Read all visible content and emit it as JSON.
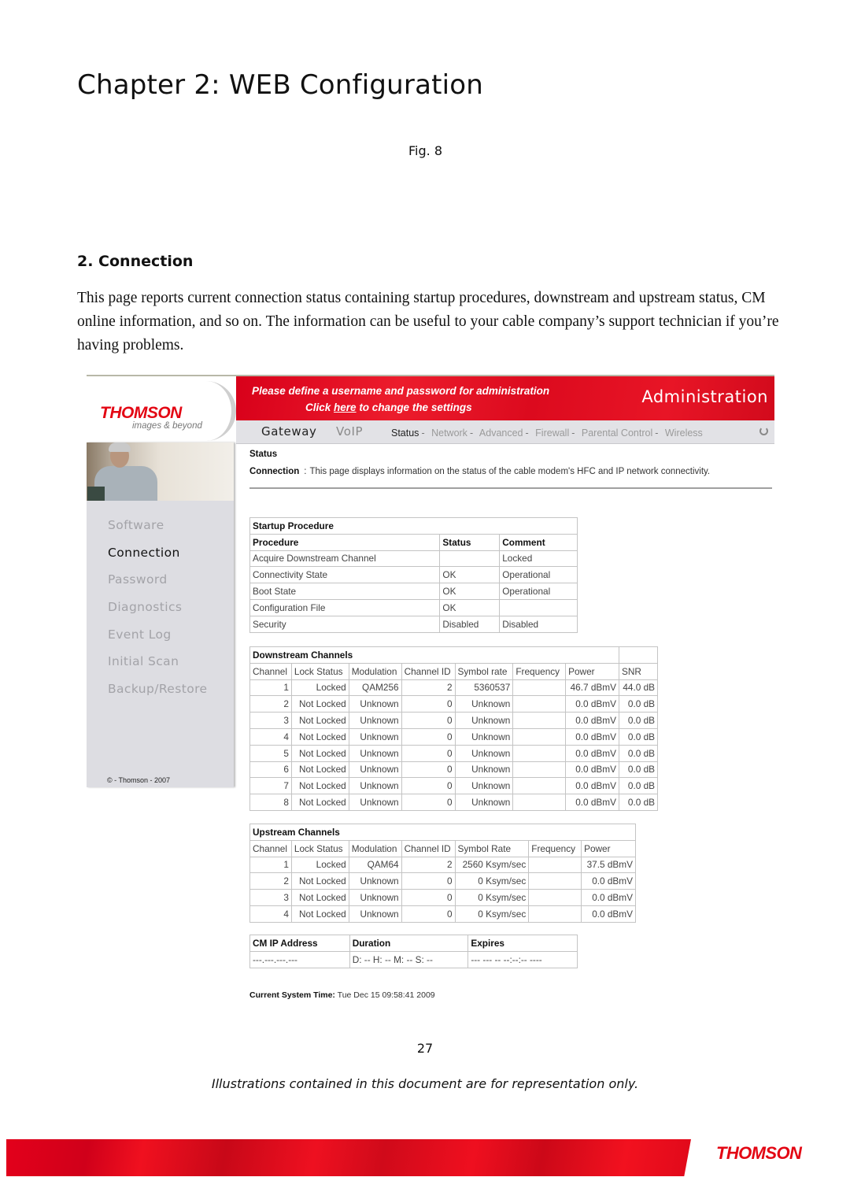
{
  "document": {
    "chapter_title": "Chapter 2: WEB Configuration",
    "fig_label": "Fig. 8",
    "section_heading": "2. Connection",
    "intro_paragraph": "This page reports current connection status containing startup procedures, downstream and upstream status, CM online information, and so on. The information can be useful to your cable company’s support technician if you’re having problems.",
    "page_number": "27",
    "disclaimer": "Illustrations contained in this document are for representation only.",
    "footer_logo": "THOMSON"
  },
  "screenshot": {
    "logo": {
      "brand": "THOMSON",
      "tagline": "images & beyond"
    },
    "banner": {
      "line1": "Please define a username and password for administration",
      "line2_prefix": "Click ",
      "line2_link": "here",
      "line2_suffix": " to change the settings",
      "title": "Administration"
    },
    "nav": {
      "main": [
        "Gateway",
        "VoIP"
      ],
      "sub": [
        {
          "label": "Status",
          "active": true
        },
        {
          "label": "Network",
          "active": false
        },
        {
          "label": "Advanced",
          "active": false
        },
        {
          "label": "Firewall",
          "active": false
        },
        {
          "label": "Parental Control",
          "active": false
        },
        {
          "label": "Wireless",
          "active": false
        }
      ],
      "separator": "-",
      "refresh_icon": "refresh-icon"
    },
    "sidebar": {
      "items": [
        "Software",
        "Connection",
        "Password",
        "Diagnostics",
        "Event Log",
        "Initial Scan",
        "Backup/Restore"
      ],
      "active_index": 1,
      "copyright": "© - Thomson - 2007"
    },
    "content": {
      "heading": "Status",
      "desc_label": "Connection",
      "desc_sep": ":",
      "desc_text": "This page displays information on the status of the cable modem's HFC and IP network connectivity."
    },
    "startup": {
      "title": "Startup Procedure",
      "headers": [
        "Procedure",
        "Status",
        "Comment"
      ],
      "rows": [
        [
          "Acquire Downstream Channel",
          "",
          "Locked"
        ],
        [
          "Connectivity State",
          "OK",
          "Operational"
        ],
        [
          "Boot State",
          "OK",
          "Operational"
        ],
        [
          "Configuration File",
          "OK",
          ""
        ],
        [
          "Security",
          "Disabled",
          "Disabled"
        ]
      ]
    },
    "downstream": {
      "title": "Downstream Channels",
      "headers": [
        "Channel",
        "Lock Status",
        "Modulation",
        "Channel ID",
        "Symbol rate",
        "Frequency",
        "Power",
        "SNR"
      ],
      "rows": [
        [
          "1",
          "Locked",
          "QAM256",
          "2",
          "5360537",
          "",
          "46.7 dBmV",
          "44.0 dB"
        ],
        [
          "2",
          "Not Locked",
          "Unknown",
          "0",
          "Unknown",
          "",
          "0.0 dBmV",
          "0.0 dB"
        ],
        [
          "3",
          "Not Locked",
          "Unknown",
          "0",
          "Unknown",
          "",
          "0.0 dBmV",
          "0.0 dB"
        ],
        [
          "4",
          "Not Locked",
          "Unknown",
          "0",
          "Unknown",
          "",
          "0.0 dBmV",
          "0.0 dB"
        ],
        [
          "5",
          "Not Locked",
          "Unknown",
          "0",
          "Unknown",
          "",
          "0.0 dBmV",
          "0.0 dB"
        ],
        [
          "6",
          "Not Locked",
          "Unknown",
          "0",
          "Unknown",
          "",
          "0.0 dBmV",
          "0.0 dB"
        ],
        [
          "7",
          "Not Locked",
          "Unknown",
          "0",
          "Unknown",
          "",
          "0.0 dBmV",
          "0.0 dB"
        ],
        [
          "8",
          "Not Locked",
          "Unknown",
          "0",
          "Unknown",
          "",
          "0.0 dBmV",
          "0.0 dB"
        ]
      ]
    },
    "upstream": {
      "title": "Upstream Channels",
      "headers": [
        "Channel",
        "Lock Status",
        "Modulation",
        "Channel ID",
        "Symbol Rate",
        "Frequency",
        "Power"
      ],
      "rows": [
        [
          "1",
          "Locked",
          "QAM64",
          "2",
          "2560 Ksym/sec",
          "",
          "37.5 dBmV"
        ],
        [
          "2",
          "Not Locked",
          "Unknown",
          "0",
          "0 Ksym/sec",
          "",
          "0.0 dBmV"
        ],
        [
          "3",
          "Not Locked",
          "Unknown",
          "0",
          "0 Ksym/sec",
          "",
          "0.0 dBmV"
        ],
        [
          "4",
          "Not Locked",
          "Unknown",
          "0",
          "0 Ksym/sec",
          "",
          "0.0 dBmV"
        ]
      ]
    },
    "cm_ip": {
      "headers": [
        "CM IP Address",
        "Duration",
        "Expires"
      ],
      "values": [
        "---.---.---.---",
        "D: -- H: -- M: -- S: --",
        "--- --- -- --:--:-- ----"
      ]
    },
    "system_time": {
      "label": "Current System Time:",
      "value": "Tue Dec 15 09:58:41 2009"
    }
  },
  "colors": {
    "brand_red": "#e30613",
    "nav_bg": "#e2e2e6",
    "sidebar_bg": "#dddde2",
    "inactive_text": "#a3a3a8"
  }
}
